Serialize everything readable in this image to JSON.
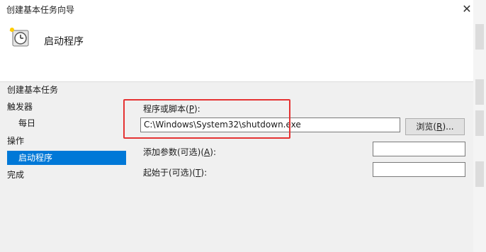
{
  "window": {
    "title": "创建基本任务向导",
    "close_glyph": "✕"
  },
  "header": {
    "heading": "启动程序",
    "icon": "task-scheduler-clock-icon"
  },
  "nav": {
    "items": [
      {
        "label": "创建基本任务"
      },
      {
        "label": "触发器"
      },
      {
        "label": "每日"
      },
      {
        "label": "操作"
      },
      {
        "label": "启动程序"
      },
      {
        "label": "完成"
      }
    ]
  },
  "form": {
    "program": {
      "label_prefix": "程序或脚本(",
      "label_key": "P",
      "label_suffix": "):",
      "value": "C:\\Windows\\System32\\shutdown.exe"
    },
    "browse": {
      "label_prefix": "浏览(",
      "label_key": "R",
      "label_suffix": ")..."
    },
    "args": {
      "label_prefix": "添加参数(可选)(",
      "label_key": "A",
      "label_suffix": "):",
      "value": ""
    },
    "startin": {
      "label_prefix": "起始于(可选)(",
      "label_key": "T",
      "label_suffix": "):",
      "value": ""
    }
  },
  "colors": {
    "selection": "#0078d7",
    "highlight_box": "#e53333"
  }
}
